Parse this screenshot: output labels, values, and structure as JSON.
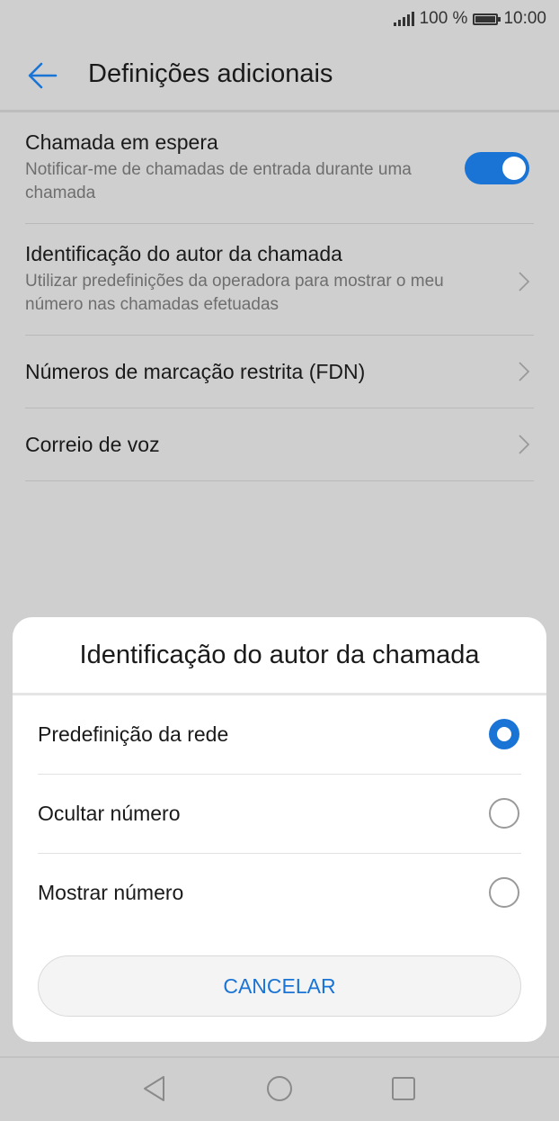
{
  "status_bar": {
    "battery": "100 %",
    "time": "10:00",
    "signal_icon": "signal-icon",
    "battery_icon": "battery-icon"
  },
  "header": {
    "title": "Definições adicionais",
    "back_icon": "arrow-left-icon"
  },
  "settings": [
    {
      "title": "Chamada em espera",
      "subtitle": "Notificar-me de chamadas de entrada durante uma chamada",
      "control": "toggle",
      "enabled": true
    },
    {
      "title": "Identificação do autor da chamada",
      "subtitle": "Utilizar predefinições da operadora para mostrar o meu número nas chamadas efetuadas",
      "control": "chevron"
    },
    {
      "title": "Números de marcação restrita (FDN)",
      "control": "chevron"
    },
    {
      "title": "Correio de voz",
      "control": "chevron"
    }
  ],
  "dialog": {
    "title": "Identificação do autor da chamada",
    "options": [
      {
        "label": "Predefinição da rede",
        "selected": true
      },
      {
        "label": "Ocultar número",
        "selected": false
      },
      {
        "label": "Mostrar número",
        "selected": false
      }
    ],
    "cancel_label": "CANCELAR"
  },
  "colors": {
    "accent": "#1a74d6",
    "background": "#cfcfcf",
    "dialog": "#ffffff"
  },
  "nav_bar": {
    "icons": [
      "back-triangle-icon",
      "home-circle-icon",
      "recents-square-icon"
    ]
  }
}
